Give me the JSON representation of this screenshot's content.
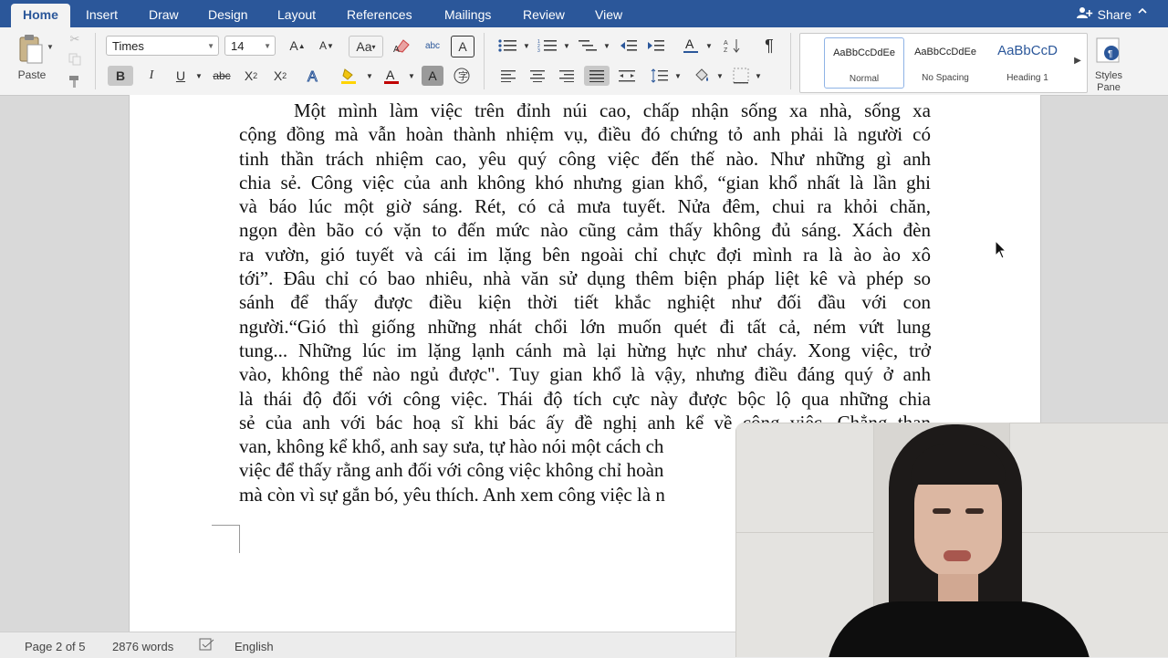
{
  "tabs": [
    "Home",
    "Insert",
    "Draw",
    "Design",
    "Layout",
    "References",
    "Mailings",
    "Review",
    "View"
  ],
  "share_label": "Share",
  "clipboard": {
    "paste_label": "Paste"
  },
  "font": {
    "family": "Times",
    "size": "14"
  },
  "styles": [
    {
      "preview": "AaBbCcDdEe",
      "label": "Normal"
    },
    {
      "preview": "AaBbCcDdEe",
      "label": "No Spacing"
    },
    {
      "preview": "AaBbCcD",
      "label": "Heading 1"
    }
  ],
  "styles_pane_label": [
    "Styles",
    "Pane"
  ],
  "document": {
    "lines": [
      "Một mình làm việc trên đỉnh núi cao, chấp nhận sống xa nhà, sống xa",
      "cộng đồng mà vẫn hoàn thành nhiệm vụ, điều đó chứng tỏ anh phải là người có",
      "tinh thần trách nhiệm cao, yêu quý công việc đến thế nào. Như những gì anh",
      "chia sẻ. Công việc của anh không khó nhưng gian khổ, “gian khổ nhất là lần ghi",
      "và báo lúc một giờ sáng. Rét, có cả mưa tuyết. Nửa đêm, chui ra khỏi chăn,",
      "ngọn đèn bão có vặn to đến mức nào cũng cảm thấy không đủ sáng. Xách đèn",
      "ra vườn, gió tuyết và cái im lặng bên ngoài chỉ chực đợi mình ra là ào ào xô",
      "tới”. Đâu chỉ có bao nhiêu, nhà văn sử dụng thêm biện pháp liệt kê và phép so",
      "sánh để thấy được điều kiện thời tiết khắc nghiệt như đối đầu với con",
      "người.“Gió thì giống những nhát chổi lớn muốn quét đi tất cả, ném vứt lung",
      "tung... Những lúc im lặng lạnh cánh mà lại hừng hực như cháy. Xong việc, trở",
      "vào, không thể nào ngủ được\". Tuy gian khổ là vậy, nhưng điều đáng quý ở anh",
      "là thái độ đối với công việc. Thái độ tích cực này được bộc lộ qua những chia",
      "sẻ của anh với bác hoạ sĩ khi bác ấy đề nghị anh kể về công việc. Chẳng than",
      "van, không kể khổ, anh say sưa, tự hào nói một cách ch",
      "việc để thấy rằng anh đối với công việc không chỉ hoàn",
      "mà còn vì sự gắn bó, yêu thích. Anh xem công việc là n"
    ]
  },
  "status": {
    "page": "Page 2 of 5",
    "words": "2876 words",
    "language": "English"
  },
  "colors": {
    "ribbon_blue": "#2b579a",
    "accent_highlight": "#ffd400",
    "font_color": "#c00000"
  }
}
